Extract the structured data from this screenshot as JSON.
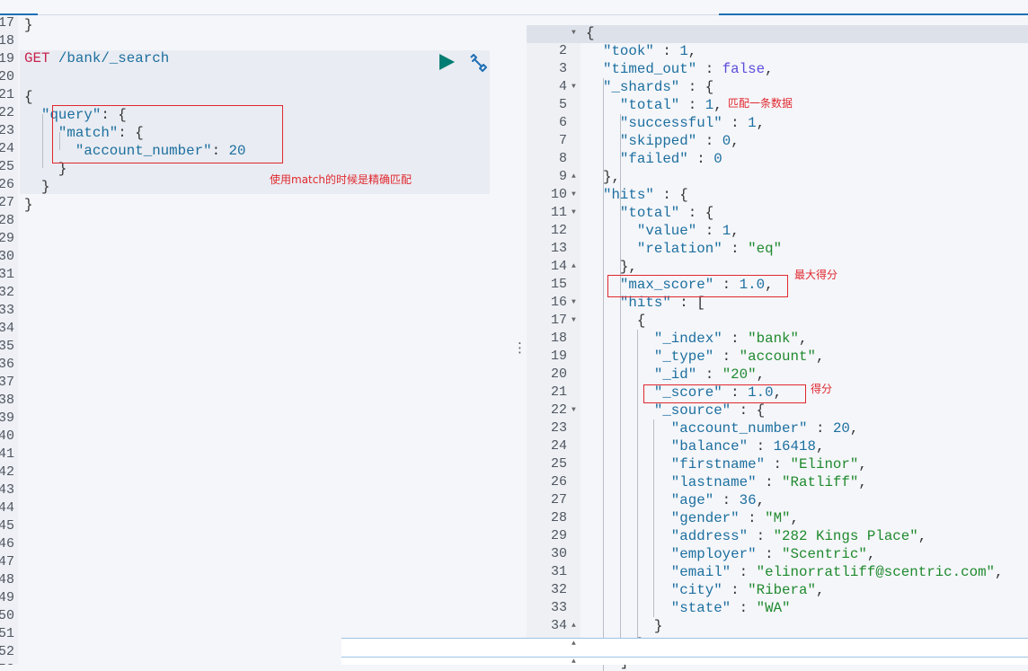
{
  "request": {
    "method": "GET",
    "path": " /bank/_search",
    "first_line_number": 17,
    "lines": [
      "}",
      "",
      "",
      "{",
      "  \"query\": {",
      "    \"match\": {",
      "      \"account_number\": 20",
      "    }",
      "  }",
      "}"
    ],
    "run_icon": "play-icon",
    "settings_icon": "wrench-icon"
  },
  "response": {
    "lines": [
      "{",
      "  \"took\" : 1,",
      "  \"timed_out\" : false,",
      "  \"_shards\" : {",
      "    \"total\" : 1,",
      "    \"successful\" : 1,",
      "    \"skipped\" : 0,",
      "    \"failed\" : 0",
      "  },",
      "  \"hits\" : {",
      "    \"total\" : {",
      "      \"value\" : 1,",
      "      \"relation\" : \"eq\"",
      "    },",
      "    \"max_score\" : 1.0,",
      "    \"hits\" : [",
      "      {",
      "        \"_index\" : \"bank\",",
      "        \"_type\" : \"account\",",
      "        \"_id\" : \"20\",",
      "        \"_score\" : 1.0,",
      "        \"_source\" : {",
      "          \"account_number\" : 20,",
      "          \"balance\" : 16418,",
      "          \"firstname\" : \"Elinor\",",
      "          \"lastname\" : \"Ratliff\",",
      "          \"age\" : 36,",
      "          \"gender\" : \"M\",",
      "          \"address\" : \"282 Kings Place\",",
      "          \"employer\" : \"Scentric\",",
      "          \"email\" : \"elinorratliff@scentric.com\",",
      "          \"city\" : \"Ribera\",",
      "          \"state\" : \"WA\"",
      "        }",
      "      }",
      "    ]"
    ]
  },
  "annotations": {
    "match_note": "使用match的时候是精确匹配",
    "total_note": "匹配一条数据",
    "max_score_note": "最大得分",
    "score_note": "得分"
  },
  "colors": {
    "accent": "#1f6fb5",
    "annotation": "#e0282e",
    "run": "#017d73"
  }
}
